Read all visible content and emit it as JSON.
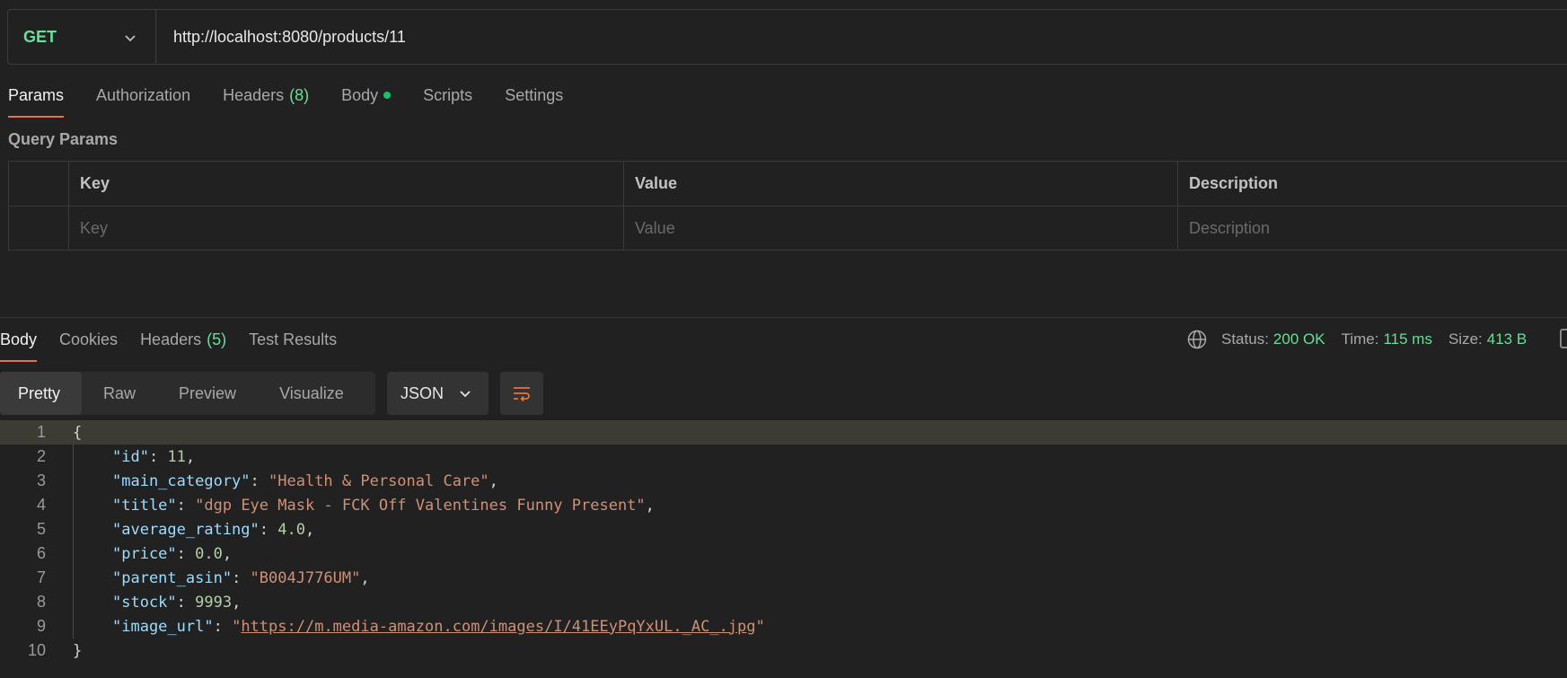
{
  "request": {
    "method": "GET",
    "url": "http://localhost:8080/products/11",
    "tabs": [
      {
        "label": "Params"
      },
      {
        "label": "Authorization"
      },
      {
        "label": "Headers",
        "count": "(8)"
      },
      {
        "label": "Body"
      },
      {
        "label": "Scripts"
      },
      {
        "label": "Settings"
      }
    ],
    "active_tab": "Params"
  },
  "query_params": {
    "title": "Query Params",
    "headers": [
      "Key",
      "Value",
      "Description"
    ],
    "placeholders": [
      "Key",
      "Value",
      "Description"
    ]
  },
  "response": {
    "tabs": [
      {
        "label": "Body"
      },
      {
        "label": "Cookies"
      },
      {
        "label": "Headers",
        "count": "(5)"
      },
      {
        "label": "Test Results"
      }
    ],
    "active_tab": "Body",
    "status_label": "Status:",
    "status_value": "200 OK",
    "time_label": "Time:",
    "time_value": "115 ms",
    "size_label": "Size:",
    "size_value": "413 B",
    "view_modes": [
      "Pretty",
      "Raw",
      "Preview",
      "Visualize"
    ],
    "active_view": "Pretty",
    "format": "JSON"
  },
  "body": {
    "line_numbers": [
      "1",
      "2",
      "3",
      "4",
      "5",
      "6",
      "7",
      "8",
      "9",
      "10"
    ],
    "open": "{",
    "close": "}",
    "fields": [
      {
        "key": "\"id\"",
        "sep": ": ",
        "value": "11",
        "type": "number",
        "comma": ","
      },
      {
        "key": "\"main_category\"",
        "sep": ": ",
        "value": "\"Health & Personal Care\"",
        "type": "string",
        "comma": ","
      },
      {
        "key": "\"title\"",
        "sep": ": ",
        "value": "\"dgp Eye Mask - FCK Off Valentines Funny Present\"",
        "type": "string",
        "comma": ","
      },
      {
        "key": "\"average_rating\"",
        "sep": ": ",
        "value": "4.0",
        "type": "number",
        "comma": ","
      },
      {
        "key": "\"price\"",
        "sep": ": ",
        "value": "0.0",
        "type": "number",
        "comma": ","
      },
      {
        "key": "\"parent_asin\"",
        "sep": ": ",
        "value": "\"B004J776UM\"",
        "type": "string",
        "comma": ","
      },
      {
        "key": "\"stock\"",
        "sep": ": ",
        "value": "9993",
        "type": "number",
        "comma": ","
      },
      {
        "key": "\"image_url\"",
        "sep": ": ",
        "value_open": "\"",
        "link": "https://m.media-amazon.com/images/I/41EEyPqYxUL._AC_.jpg",
        "value_close": "\"",
        "type": "link",
        "comma": ""
      }
    ]
  },
  "colors": {
    "method": "#6bdd9a",
    "accent": "#e8743b",
    "status_ok": "#6bdd9a",
    "json_key": "#9cdcfe",
    "json_string": "#ce9178",
    "json_number": "#b5cea8"
  }
}
